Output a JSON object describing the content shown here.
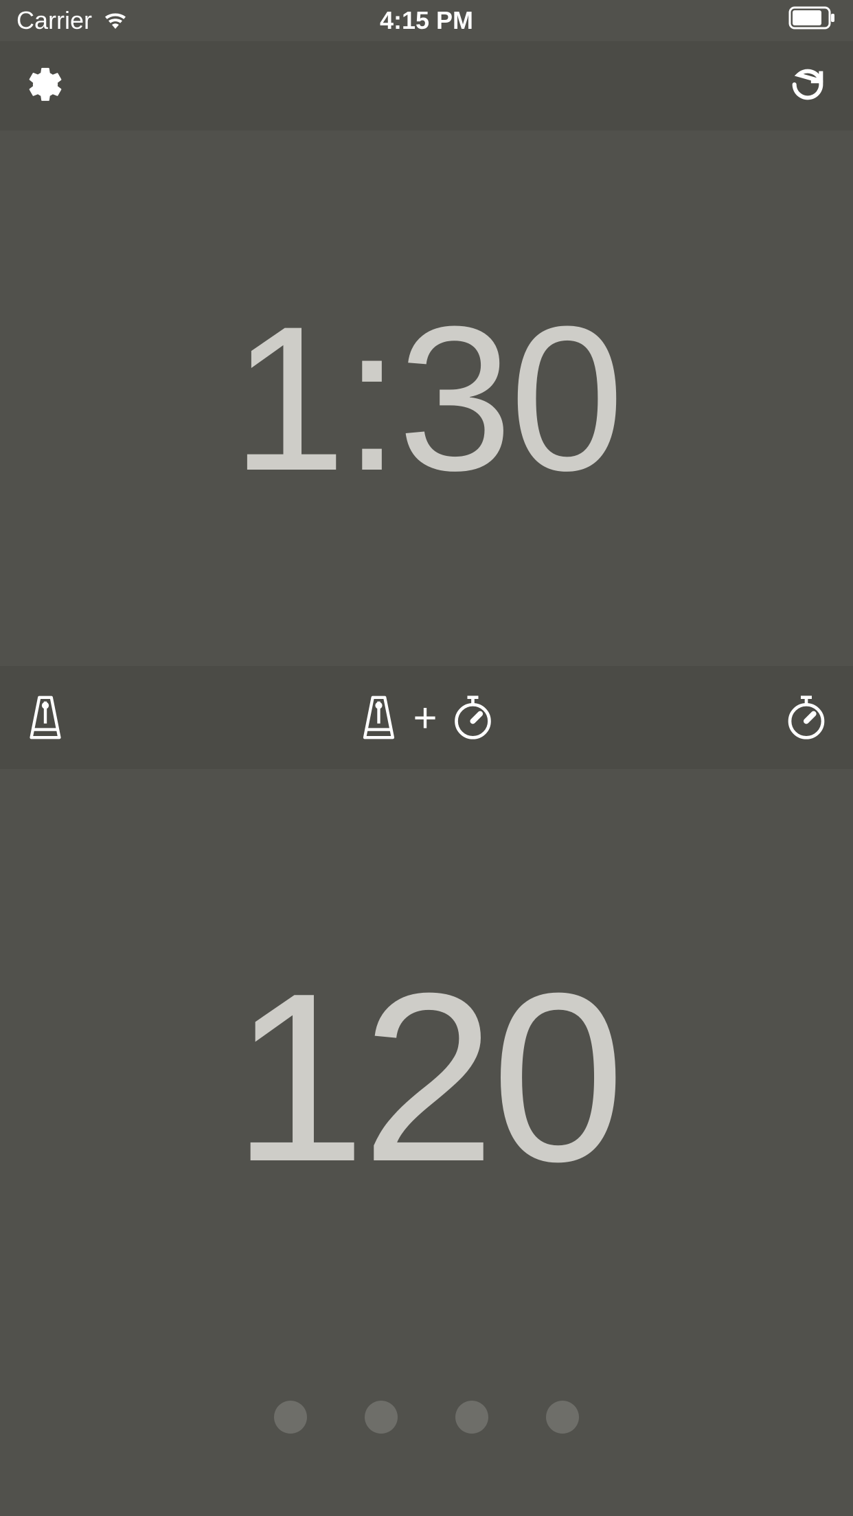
{
  "status_bar": {
    "carrier": "Carrier",
    "time": "4:15 PM"
  },
  "timer": {
    "value": "1:30"
  },
  "bpm": {
    "value": "120"
  },
  "mode_bar": {
    "plus": "+"
  },
  "page_dots": {
    "count": 4
  }
}
